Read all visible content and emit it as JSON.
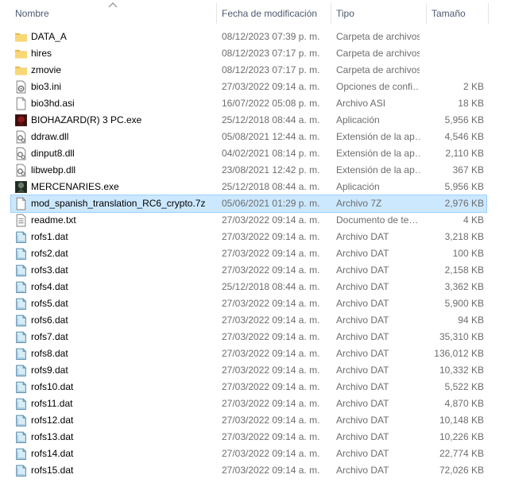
{
  "columns": {
    "name": "Nombre",
    "date": "Fecha de modificación",
    "type": "Tipo",
    "size": "Tamaño"
  },
  "sort_icon": "chevron-up-icon",
  "selected_index": 10,
  "files": [
    {
      "name": "DATA_A",
      "date": "08/12/2023 07:39 p. m.",
      "type": "Carpeta de archivos",
      "size": "",
      "icon": "folder-icon"
    },
    {
      "name": "hires",
      "date": "08/12/2023 07:17 p. m.",
      "type": "Carpeta de archivos",
      "size": "",
      "icon": "folder-icon"
    },
    {
      "name": "zmovie",
      "date": "08/12/2023 07:17 p. m.",
      "type": "Carpeta de archivos",
      "size": "",
      "icon": "folder-icon"
    },
    {
      "name": "bio3.ini",
      "date": "27/03/2022 09:14 a. m.",
      "type": "Opciones de confi…",
      "size": "2 KB",
      "icon": "ini-file-icon"
    },
    {
      "name": "bio3hd.asi",
      "date": "16/07/2022 05:08 p. m.",
      "type": "Archivo ASI",
      "size": "18 KB",
      "icon": "file-icon"
    },
    {
      "name": "BIOHAZARD(R) 3 PC.exe",
      "date": "25/12/2018 08:44 a. m.",
      "type": "Aplicación",
      "size": "5,956 KB",
      "icon": "biohazard-app-icon"
    },
    {
      "name": "ddraw.dll",
      "date": "05/08/2021 12:44 a. m.",
      "type": "Extensión de la ap…",
      "size": "4,546 KB",
      "icon": "dll-file-icon"
    },
    {
      "name": "dinput8.dll",
      "date": "04/02/2021 08:14 p. m.",
      "type": "Extensión de la ap…",
      "size": "2,110 KB",
      "icon": "dll-file-icon"
    },
    {
      "name": "libwebp.dll",
      "date": "23/08/2021 12:42 p. m.",
      "type": "Extensión de la ap…",
      "size": "367 KB",
      "icon": "dll-file-icon"
    },
    {
      "name": "MERCENARIES.exe",
      "date": "25/12/2018 08:44 a. m.",
      "type": "Aplicación",
      "size": "5,956 KB",
      "icon": "mercenaries-app-icon"
    },
    {
      "name": "mod_spanish_translation_RC6_crypto.7z",
      "date": "05/06/2021 01:29 p. m.",
      "type": "Archivo 7Z",
      "size": "2,976 KB",
      "icon": "file-icon"
    },
    {
      "name": "readme.txt",
      "date": "27/03/2022 09:14 a. m.",
      "type": "Documento de te…",
      "size": "4 KB",
      "icon": "text-file-icon"
    },
    {
      "name": "rofs1.dat",
      "date": "27/03/2022 09:14 a. m.",
      "type": "Archivo DAT",
      "size": "3,218 KB",
      "icon": "dat-file-icon"
    },
    {
      "name": "rofs2.dat",
      "date": "27/03/2022 09:14 a. m.",
      "type": "Archivo DAT",
      "size": "100 KB",
      "icon": "dat-file-icon"
    },
    {
      "name": "rofs3.dat",
      "date": "27/03/2022 09:14 a. m.",
      "type": "Archivo DAT",
      "size": "2,158 KB",
      "icon": "dat-file-icon"
    },
    {
      "name": "rofs4.dat",
      "date": "25/12/2018 08:44 a. m.",
      "type": "Archivo DAT",
      "size": "3,362 KB",
      "icon": "dat-file-icon"
    },
    {
      "name": "rofs5.dat",
      "date": "27/03/2022 09:14 a. m.",
      "type": "Archivo DAT",
      "size": "5,900 KB",
      "icon": "dat-file-icon"
    },
    {
      "name": "rofs6.dat",
      "date": "27/03/2022 09:14 a. m.",
      "type": "Archivo DAT",
      "size": "94 KB",
      "icon": "dat-file-icon"
    },
    {
      "name": "rofs7.dat",
      "date": "27/03/2022 09:14 a. m.",
      "type": "Archivo DAT",
      "size": "35,310 KB",
      "icon": "dat-file-icon"
    },
    {
      "name": "rofs8.dat",
      "date": "27/03/2022 09:14 a. m.",
      "type": "Archivo DAT",
      "size": "136,012 KB",
      "icon": "dat-file-icon"
    },
    {
      "name": "rofs9.dat",
      "date": "27/03/2022 09:14 a. m.",
      "type": "Archivo DAT",
      "size": "10,332 KB",
      "icon": "dat-file-icon"
    },
    {
      "name": "rofs10.dat",
      "date": "27/03/2022 09:14 a. m.",
      "type": "Archivo DAT",
      "size": "5,522 KB",
      "icon": "dat-file-icon"
    },
    {
      "name": "rofs11.dat",
      "date": "27/03/2022 09:14 a. m.",
      "type": "Archivo DAT",
      "size": "4,870 KB",
      "icon": "dat-file-icon"
    },
    {
      "name": "rofs12.dat",
      "date": "27/03/2022 09:14 a. m.",
      "type": "Archivo DAT",
      "size": "10,148 KB",
      "icon": "dat-file-icon"
    },
    {
      "name": "rofs13.dat",
      "date": "27/03/2022 09:14 a. m.",
      "type": "Archivo DAT",
      "size": "10,226 KB",
      "icon": "dat-file-icon"
    },
    {
      "name": "rofs14.dat",
      "date": "27/03/2022 09:14 a. m.",
      "type": "Archivo DAT",
      "size": "22,774 KB",
      "icon": "dat-file-icon"
    },
    {
      "name": "rofs15.dat",
      "date": "27/03/2022 09:14 a. m.",
      "type": "Archivo DAT",
      "size": "72,026 KB",
      "icon": "dat-file-icon"
    }
  ],
  "colors": {
    "folder": "#f8d775",
    "selection_bg": "#cce8ff",
    "selection_border": "#99d1ff",
    "header_text": "#4c5b6f"
  }
}
